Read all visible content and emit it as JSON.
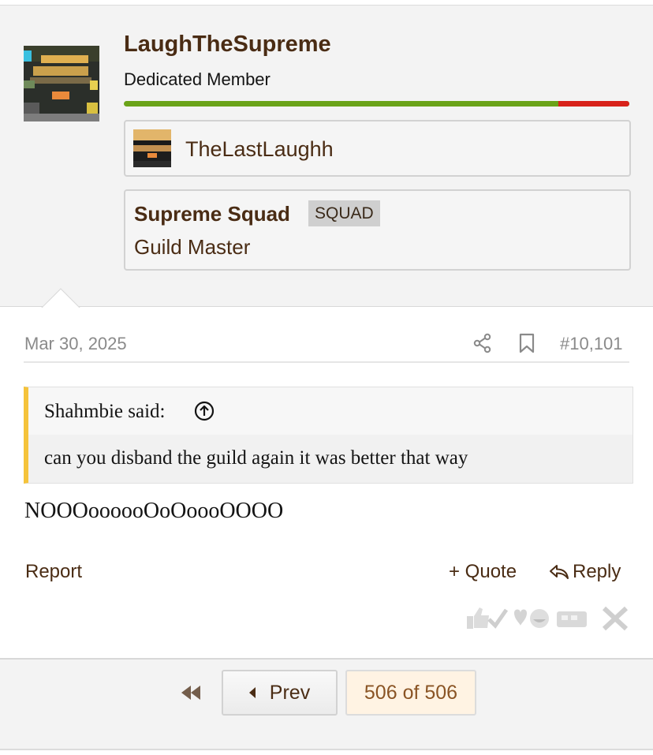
{
  "user": {
    "username": "LaughTheSupreme",
    "title": "Dedicated Member",
    "reputation": {
      "positive_fraction": 0.86,
      "negative_fraction": 0.14,
      "positive_color": "#6aa318",
      "negative_color": "#d8221a"
    },
    "minecraft_name": "TheLastLaughh",
    "guild": {
      "name": "Supreme Squad",
      "tag": "SQUAD",
      "rank": "Guild Master"
    }
  },
  "post": {
    "date": "Mar 30, 2025",
    "number": "#10,101",
    "icons": [
      "share-icon",
      "bookmark-icon"
    ],
    "quote": {
      "author": "Shahmbie said:",
      "text": "can you disband the guild again it was better that way"
    },
    "body": "NOOOoooooOoOoooOOOO",
    "actions": {
      "report": "Report",
      "quote": "+ Quote",
      "reply": "Reply"
    },
    "reactions": [
      "like-icon",
      "agree-icon",
      "love-icon",
      "funny-icon",
      "creative-icon",
      "disagree-icon"
    ]
  },
  "pagination": {
    "prev": "Prev",
    "status": "506 of 506"
  },
  "colors": {
    "brand_brown": "#4a2c14",
    "quote_accent": "#f5c33b",
    "panel_bg": "#f3f3f3"
  }
}
